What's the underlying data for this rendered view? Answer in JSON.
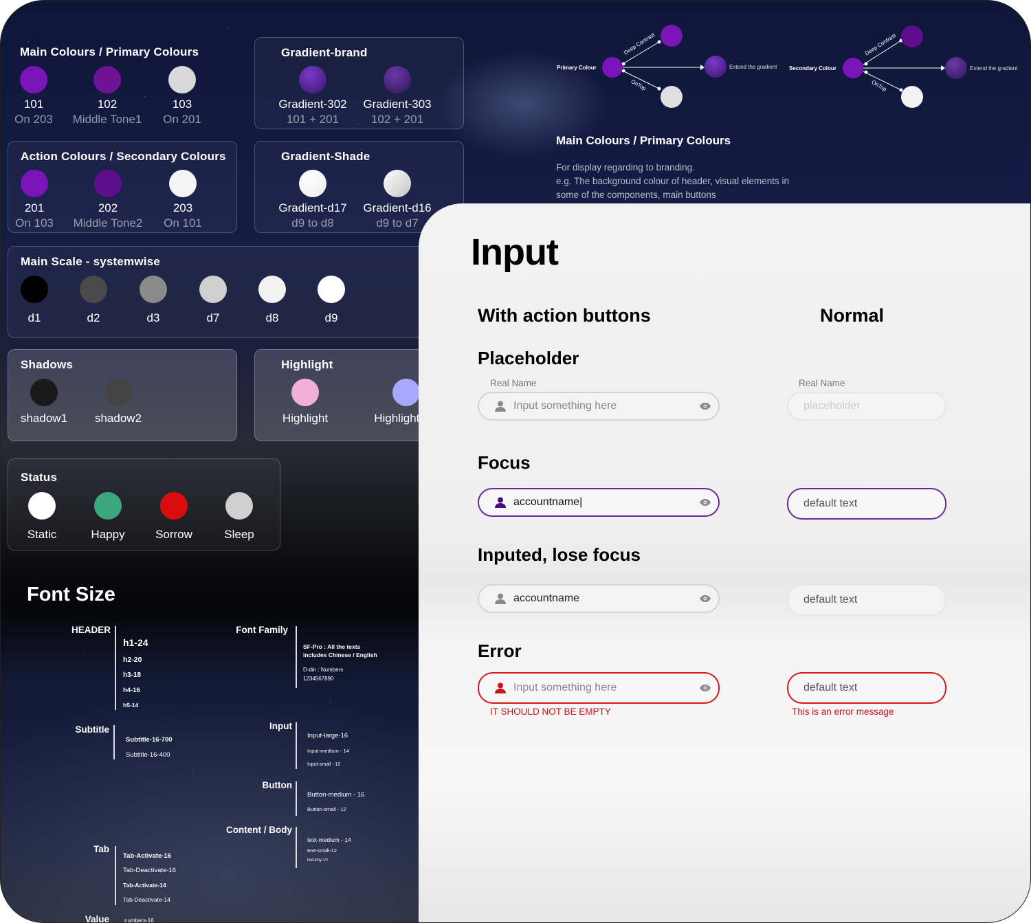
{
  "palette": {
    "main_title": "Main Colours / Primary Colours",
    "main": [
      {
        "code": "101",
        "sub": "On 203",
        "color": "#7a14b8"
      },
      {
        "code": "102",
        "sub": "Middle Tone1",
        "color": "#6e1296"
      },
      {
        "code": "103",
        "sub": "On 201",
        "color": "#d9d9d9"
      }
    ],
    "grad_brand_title": "Gradient-brand",
    "grad_brand": [
      {
        "code": "Gradient-302",
        "sub": "101 + 201",
        "color": "#5c1e9a"
      },
      {
        "code": "Gradient-303",
        "sub": "102 + 201",
        "color": "#4e1e78"
      }
    ],
    "action_title": "Action Colours / Secondary Colours",
    "action": [
      {
        "code": "201",
        "sub": "On 103",
        "color": "#7a14b8"
      },
      {
        "code": "202",
        "sub": "Middle Tone2",
        "color": "#5e0e8c"
      },
      {
        "code": "203",
        "sub": "On 101",
        "color": "#f4f4f4"
      }
    ],
    "grad_shade_title": "Gradient-Shade",
    "grad_shade": [
      {
        "code": "Gradient-d17",
        "sub": "d9 to d8",
        "color": "#fafafa"
      },
      {
        "code": "Gradient-d16",
        "sub": "d9 to d7",
        "color": "#e8e8e8"
      }
    ],
    "scale_title": "Main Scale - systemwise",
    "scale": [
      {
        "code": "d1",
        "color": "#000000"
      },
      {
        "code": "d2",
        "color": "#4a4a4a"
      },
      {
        "code": "d3",
        "color": "#8a8a8a"
      },
      {
        "code": "d7",
        "color": "#cfcfcf"
      },
      {
        "code": "d8",
        "color": "#f2f2f2"
      },
      {
        "code": "d9",
        "color": "#ffffff"
      }
    ],
    "shadows_title": "Shadows",
    "shadows": [
      {
        "code": "shadow1",
        "color": "#1a1a1a"
      },
      {
        "code": "shadow2",
        "color": "#444444"
      }
    ],
    "highlight_title": "Highlight",
    "highlight": [
      {
        "code": "Highlight",
        "color": "#f2b0d8"
      },
      {
        "code": "Highlight-Co",
        "color": "#a8a8ff"
      }
    ],
    "status_title": "Status",
    "status": [
      {
        "code": "Static",
        "color": "#ffffff"
      },
      {
        "code": "Happy",
        "color": "#3aa87c"
      },
      {
        "code": "Sorrow",
        "color": "#d80e0e"
      },
      {
        "code": "Sleep",
        "color": "#cfcfcf"
      }
    ]
  },
  "diagram": {
    "primary": "Primary Colour",
    "secondary": "Secondary Colour",
    "deep_contrast": "Deep Contrast",
    "ontop": "OnTop",
    "extend": "Extend the gradient",
    "purple": "#7a14b8",
    "grey": "#e0e0e0",
    "title": "Main Colours / Primary Colours",
    "desc_1": "For display regarding to branding.",
    "desc_2": "e.g. The background colour of header, visual elements in",
    "desc_3": "some of the components, main buttons"
  },
  "font_size": {
    "title": "Font Size",
    "header_label": "HEADER",
    "header_items": [
      "h1-24",
      "h2-20",
      "h3-18",
      "h4-16",
      "h5-14"
    ],
    "subtitle_label": "Subtitle",
    "subtitle_items": [
      "Subtitle-16-700",
      "Subtitle-16-400"
    ],
    "tab_label": "Tab",
    "tab_items": [
      "Tab-Activate-16",
      "Tab-Deactivate-16",
      "Tab-Activate-14",
      "Tab-Deactivate-14"
    ],
    "value_label": "Value",
    "value_items": [
      "numbers-16"
    ],
    "family_label": "Font Family",
    "family_1a": "SF-Pro : All the texts",
    "family_1b": "includes Chinese / English",
    "family_2a": "D-din : Numbers",
    "family_2b": "1234567890",
    "input_label": "Input",
    "input_items": [
      "Input-large-16",
      "Input-medium - 14",
      "Input-small - 12"
    ],
    "button_label": "Button",
    "button_items": [
      "Button-medium - 16",
      "Button-small - 12"
    ],
    "content_label": "Content / Body",
    "content_items": [
      "text-medium - 14",
      "text-small-12",
      "text-tiny-10"
    ]
  },
  "input": {
    "title": "Input",
    "col_action": "With action buttons",
    "col_normal": "Normal",
    "s_placeholder": "Placeholder",
    "s_focus": "Focus",
    "s_inputed": "Inputed, lose focus",
    "s_error": "Error",
    "real_name": "Real Name",
    "input_something": "Input something here",
    "placeholder": "placeholder",
    "accountname_focus": "accountname|",
    "accountname": "accountname",
    "default_text": "default text",
    "error_action": "IT SHOULD NOT BE EMPTY",
    "error_normal": "This is an error message",
    "focus_color": "#6a2a9a",
    "error_color": "#d21818"
  }
}
